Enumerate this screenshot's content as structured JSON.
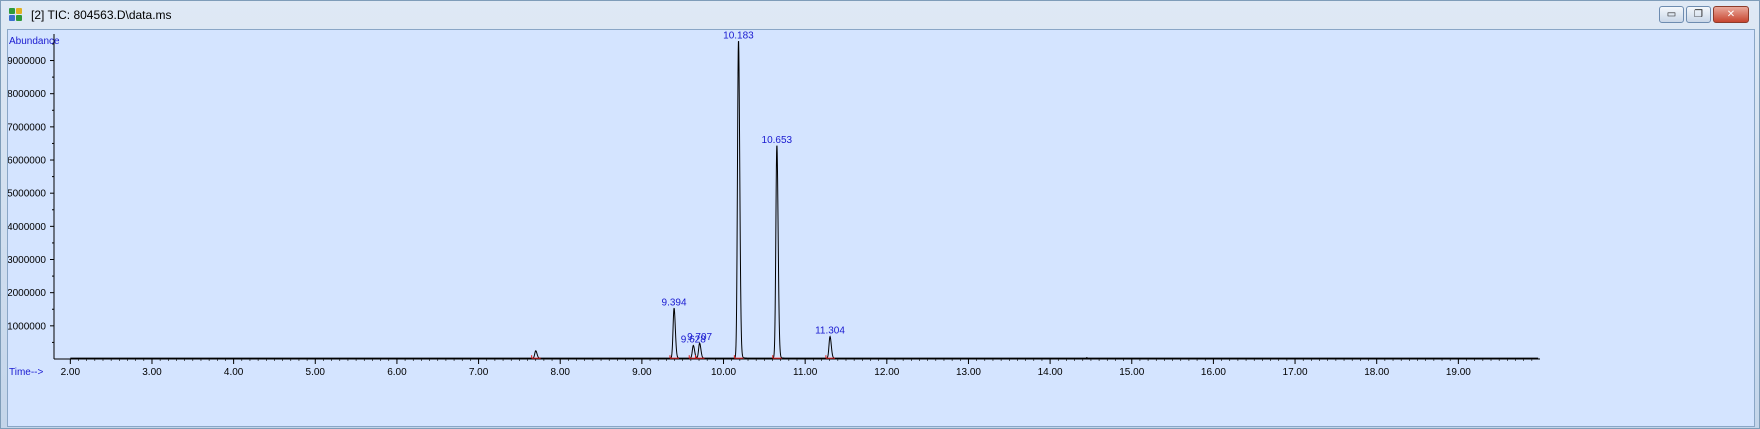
{
  "window": {
    "title": "[2] TIC: 804563.D\\data.ms",
    "buttons": [
      {
        "name": "minimize",
        "glyph": "▭"
      },
      {
        "name": "restore",
        "glyph": "❐"
      },
      {
        "name": "close",
        "glyph": "✕"
      }
    ]
  },
  "chart_data": {
    "type": "line",
    "ylabel": "Abundance",
    "xlabel": "Time-->",
    "xlim": [
      1.8,
      20.0
    ],
    "ylim": [
      0,
      9800000
    ],
    "xticks": [
      "2.00",
      "3.00",
      "4.00",
      "5.00",
      "6.00",
      "7.00",
      "8.00",
      "9.00",
      "10.00",
      "11.00",
      "12.00",
      "13.00",
      "14.00",
      "15.00",
      "16.00",
      "17.00",
      "18.00",
      "19.00"
    ],
    "yticks": [
      "1000000",
      "2000000",
      "3000000",
      "4000000",
      "5000000",
      "6000000",
      "7000000",
      "8000000",
      "9000000"
    ],
    "peaks": [
      {
        "rt": 7.7,
        "height": 220000,
        "label": ""
      },
      {
        "rt": 9.394,
        "height": 1500000,
        "label": "9.394"
      },
      {
        "rt": 9.63,
        "height": 380000,
        "label": "9.628"
      },
      {
        "rt": 9.707,
        "height": 450000,
        "label": "9.707"
      },
      {
        "rt": 10.183,
        "height": 9550000,
        "label": "10.183"
      },
      {
        "rt": 10.653,
        "height": 6400000,
        "label": "10.653"
      },
      {
        "rt": 11.304,
        "height": 650000,
        "label": "11.304"
      }
    ],
    "colors": {
      "trace": "#000000",
      "label": "#1a1ad0",
      "baseline": "#e02020",
      "background": "#d4e4ff"
    }
  }
}
